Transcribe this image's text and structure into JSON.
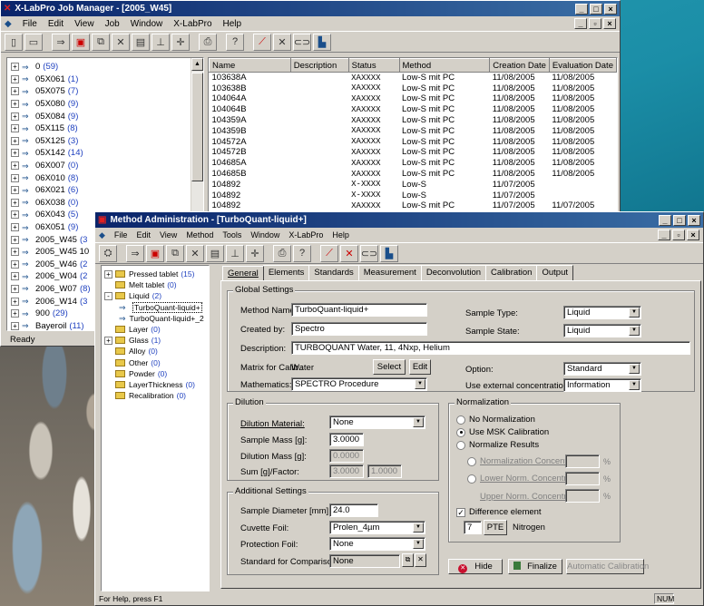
{
  "colors": {
    "titlebar": "#0a246a",
    "face": "#d4d0c8",
    "count_blue": "#1d3fbf",
    "bg": "#1b8ea7"
  },
  "job_manager": {
    "title": "X-LabPro Job Manager - [2005_W45]",
    "menu": [
      "File",
      "Edit",
      "View",
      "Job",
      "Window",
      "X-LabPro",
      "Help"
    ],
    "tree": [
      {
        "label": "0",
        "count": "(59)"
      },
      {
        "label": "05X061",
        "count": "(1)"
      },
      {
        "label": "05X075",
        "count": "(7)"
      },
      {
        "label": "05X080",
        "count": "(9)"
      },
      {
        "label": "05X084",
        "count": "(9)"
      },
      {
        "label": "05X115",
        "count": "(8)"
      },
      {
        "label": "05X125",
        "count": "(3)"
      },
      {
        "label": "05X142",
        "count": "(14)"
      },
      {
        "label": "06X007",
        "count": "(0)"
      },
      {
        "label": "06X010",
        "count": "(8)"
      },
      {
        "label": "06X021",
        "count": "(6)"
      },
      {
        "label": "06X038",
        "count": "(0)"
      },
      {
        "label": "06X043",
        "count": "(5)"
      },
      {
        "label": "06X051",
        "count": "(9)"
      },
      {
        "label": "2005_W45",
        "count": "(3"
      },
      {
        "label": "2005_W45 10",
        "count": ""
      },
      {
        "label": "2005_W46",
        "count": "(2"
      },
      {
        "label": "2006_W04",
        "count": "(2"
      },
      {
        "label": "2006_W07",
        "count": "(8)"
      },
      {
        "label": "2006_W14",
        "count": "(3"
      },
      {
        "label": "900",
        "count": "(29)"
      },
      {
        "label": "Bayeroil",
        "count": "(11)"
      }
    ],
    "columns": [
      "Name",
      "Description",
      "Status",
      "Method",
      "Creation Date",
      "Evaluation Date"
    ],
    "rows": [
      [
        "103638A",
        "",
        "XAXXXX",
        "Low-S mit PC",
        "11/08/2005",
        "11/08/2005"
      ],
      [
        "103638B",
        "",
        "XAXXXX",
        "Low-S mit PC",
        "11/08/2005",
        "11/08/2005"
      ],
      [
        "104064A",
        "",
        "XAXXXX",
        "Low-S mit PC",
        "11/08/2005",
        "11/08/2005"
      ],
      [
        "104064B",
        "",
        "XAXXXX",
        "Low-S mit PC",
        "11/08/2005",
        "11/08/2005"
      ],
      [
        "104359A",
        "",
        "XAXXXX",
        "Low-S mit PC",
        "11/08/2005",
        "11/08/2005"
      ],
      [
        "104359B",
        "",
        "XAXXXX",
        "Low-S mit PC",
        "11/08/2005",
        "11/08/2005"
      ],
      [
        "104572A",
        "",
        "XAXXXX",
        "Low-S mit PC",
        "11/08/2005",
        "11/08/2005"
      ],
      [
        "104572B",
        "",
        "XAXXXX",
        "Low-S mit PC",
        "11/08/2005",
        "11/08/2005"
      ],
      [
        "104685A",
        "",
        "XAXXXX",
        "Low-S mit PC",
        "11/08/2005",
        "11/08/2005"
      ],
      [
        "104685B",
        "",
        "XAXXXX",
        "Low-S mit PC",
        "11/08/2005",
        "11/08/2005"
      ],
      [
        "104892",
        "",
        "X-XXXX",
        "Low-S",
        "11/07/2005",
        ""
      ],
      [
        "104892",
        "",
        "X-XXXX",
        "Low-S",
        "11/07/2005",
        ""
      ],
      [
        "104892",
        "",
        "XAXXXX",
        "Low-S mit PC",
        "11/07/2005",
        "11/07/2005"
      ]
    ],
    "status": "Ready"
  },
  "method_admin": {
    "title": "Method Administration - [TurboQuant-liquid+]",
    "menu": [
      "File",
      "Edit",
      "View",
      "Method",
      "Tools",
      "Window",
      "X-LabPro",
      "Help"
    ],
    "tree": [
      {
        "label": "Pressed tablet",
        "count": "(15)",
        "level": 0,
        "exp": "+"
      },
      {
        "label": "Melt tablet",
        "count": "(0)",
        "level": 0,
        "exp": ""
      },
      {
        "label": "Liquid",
        "count": "(2)",
        "level": 0,
        "exp": "-"
      },
      {
        "label": "TurboQuant-liquid+",
        "count": "",
        "level": 1,
        "exp": "",
        "selected": true
      },
      {
        "label": "TurboQuant-liquid+_2",
        "count": "",
        "level": 1,
        "exp": ""
      },
      {
        "label": "Layer",
        "count": "(0)",
        "level": 0,
        "exp": ""
      },
      {
        "label": "Glass",
        "count": "(1)",
        "level": 0,
        "exp": "+"
      },
      {
        "label": "Alloy",
        "count": "(0)",
        "level": 0,
        "exp": ""
      },
      {
        "label": "Other",
        "count": "(0)",
        "level": 0,
        "exp": ""
      },
      {
        "label": "Powder",
        "count": "(0)",
        "level": 0,
        "exp": ""
      },
      {
        "label": "LayerThickness",
        "count": "(0)",
        "level": 0,
        "exp": ""
      },
      {
        "label": "Recalibration",
        "count": "(0)",
        "level": 0,
        "exp": ""
      }
    ],
    "tabs": [
      "General",
      "Elements",
      "Standards",
      "Measurement",
      "Deconvolution",
      "Calibration",
      "Output"
    ],
    "global": {
      "group_label": "Global Settings",
      "method_name_label": "Method Name:",
      "method_name": "TurboQuant-liquid+",
      "created_by_label": "Created by:",
      "created_by": "Spectro",
      "description_label": "Description:",
      "description": "TURBOQUANT Water, 11, 4Nxp, Helium",
      "matrix_label": "Matrix for Calib.:",
      "matrix_value": "Water",
      "select_btn": "Select",
      "edit_btn": "Edit",
      "mathematics_label": "Mathematics:",
      "mathematics": "SPECTRO Procedure",
      "sample_type_label": "Sample Type:",
      "sample_type": "Liquid",
      "sample_state_label": "Sample State:",
      "sample_state": "Liquid",
      "option_label": "Option:",
      "option": "Standard",
      "use_ext_label": "Use external concentration as:",
      "use_ext": "Information"
    },
    "dilution": {
      "group_label": "Dilution",
      "material_label": "Dilution Material:",
      "material": "None",
      "sample_mass_label": "Sample Mass [g]:",
      "sample_mass": "3.0000",
      "dilution_mass_label": "Dilution Mass [g]:",
      "dilution_mass": "0.0000",
      "sum_label": "Sum [g]/Factor:",
      "sum": "3.0000",
      "factor": "1.0000"
    },
    "additional": {
      "group_label": "Additional Settings",
      "diameter_label": "Sample Diameter [mm]:",
      "diameter": "24.0",
      "cuvette_label": "Cuvette Foil:",
      "cuvette": "Prolen_4µm",
      "protection_label": "Protection Foil:",
      "protection": "None",
      "standard_label": "Standard for Comparison:",
      "standard": "None"
    },
    "normalization": {
      "group_label": "Normalization",
      "no_norm": "No Normalization",
      "use_msk": "Use MSK Calibration",
      "normalize": "Normalize Results",
      "norm_conc": "Normalization Concentration:",
      "lower": "Lower Norm. Concentration:",
      "upper": "Upper Norm. Concentration:",
      "percent": "%",
      "diff_label": "Difference element",
      "diff_z": "7",
      "pte_btn": "PTE",
      "element": "Nitrogen"
    },
    "buttons": {
      "hide": "Hide",
      "finalize": "Finalize",
      "auto_cal": "Automatic Calibration"
    },
    "status": "For Help, press F1",
    "num": "NUM"
  }
}
